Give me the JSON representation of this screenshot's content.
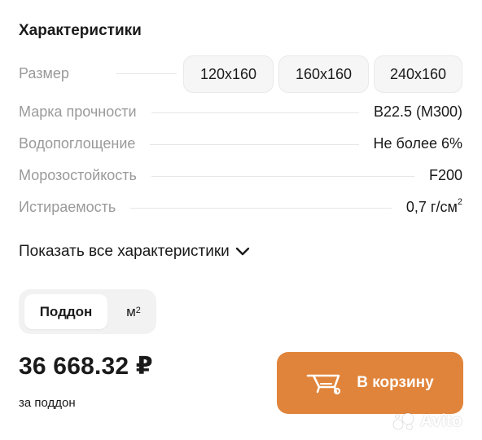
{
  "section": {
    "title": "Характеристики"
  },
  "size": {
    "label": "Размер",
    "options": [
      "120x160",
      "160x160",
      "240x160"
    ]
  },
  "specs": [
    {
      "label": "Марка прочности",
      "value": "B22.5 (M300)"
    },
    {
      "label": "Водопоглощение",
      "value": "Не более 6%"
    },
    {
      "label": "Морозостойкость",
      "value": "F200"
    },
    {
      "label": "Истираемость",
      "value": "0,7 г/см",
      "sup": "2"
    }
  ],
  "show_all": {
    "label": "Показать все характеристики",
    "icon": "chevron-down-icon"
  },
  "unit_toggle": {
    "options": [
      {
        "label": "Поддон",
        "active": true
      },
      {
        "label": "м",
        "sup": "2",
        "active": false
      }
    ]
  },
  "price": {
    "value": "36 668.32 ₽",
    "unit_label": "за поддон"
  },
  "cart_button": {
    "label": "В корзину",
    "icon": "wheelbarrow-icon",
    "color": "#e0843b"
  },
  "watermark": {
    "text": "Avito"
  }
}
